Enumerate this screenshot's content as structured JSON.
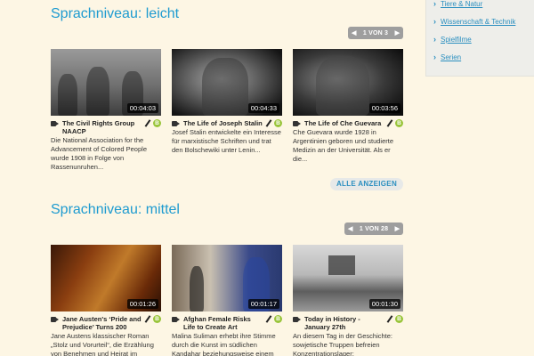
{
  "sidebar": {
    "items": [
      {
        "label": "Tiere & Natur"
      },
      {
        "label": "Wissenschaft & Technik"
      },
      {
        "label": "Spielfilme"
      },
      {
        "label": "Serien"
      }
    ]
  },
  "sections": [
    {
      "title": "Sprachniveau: leicht",
      "pager": "1 VON 3",
      "show_all": "ALLE ANZEIGEN",
      "cards": [
        {
          "duration": "00:04:03",
          "title": "The Civil Rights Group NAACP",
          "level": "B",
          "desc": "Die National Association for the Advancement of Colored People wurde 1908 in Folge von Rassenunruhen..."
        },
        {
          "duration": "00:04:33",
          "title": "The Life of Joseph Stalin",
          "level": "B",
          "desc": "Josef Stalin entwickelte ein Interesse für marxistische Schriften und trat den Bolschewiki unter Lenin..."
        },
        {
          "duration": "00:03:56",
          "title": "The Life of Che Guevara",
          "level": "B",
          "desc": "Che Guevara wurde 1928 in Argentinien geboren und studierte Medizin an der Universität. Als er die..."
        }
      ]
    },
    {
      "title": "Sprachniveau: mittel",
      "pager": "1 VON 28",
      "cards": [
        {
          "duration": "00:01:26",
          "title": "Jane Austen's ‘Pride and Prejudice’ Turns 200",
          "level": "B",
          "desc": "Jane Austens klassischer Roman „Stolz und Vorurteil“, die Erzählung von Benehmen und Heirat im"
        },
        {
          "duration": "00:01:17",
          "title": "Afghan Female Risks Life to Create Art",
          "level": "B",
          "desc": "Malina Suliman erhebt ihre Stimme durch die Kunst im südlichen Kandahar beziehungsweise einem"
        },
        {
          "duration": "00:01:30",
          "title": "Today in History - January 27th",
          "level": "B",
          "desc": "An diesem Tag in der Geschichte: sowjetische Truppen befreien Konzentrationslager;"
        }
      ]
    }
  ],
  "icons": {
    "pager_prev": "◀",
    "pager_next": "▶",
    "sidebar_chevron": "›"
  },
  "colors": {
    "accent": "#1e9bd0",
    "link": "#2b8fc0",
    "level_badge": "#9ac53c",
    "background": "#fdf6e4"
  }
}
